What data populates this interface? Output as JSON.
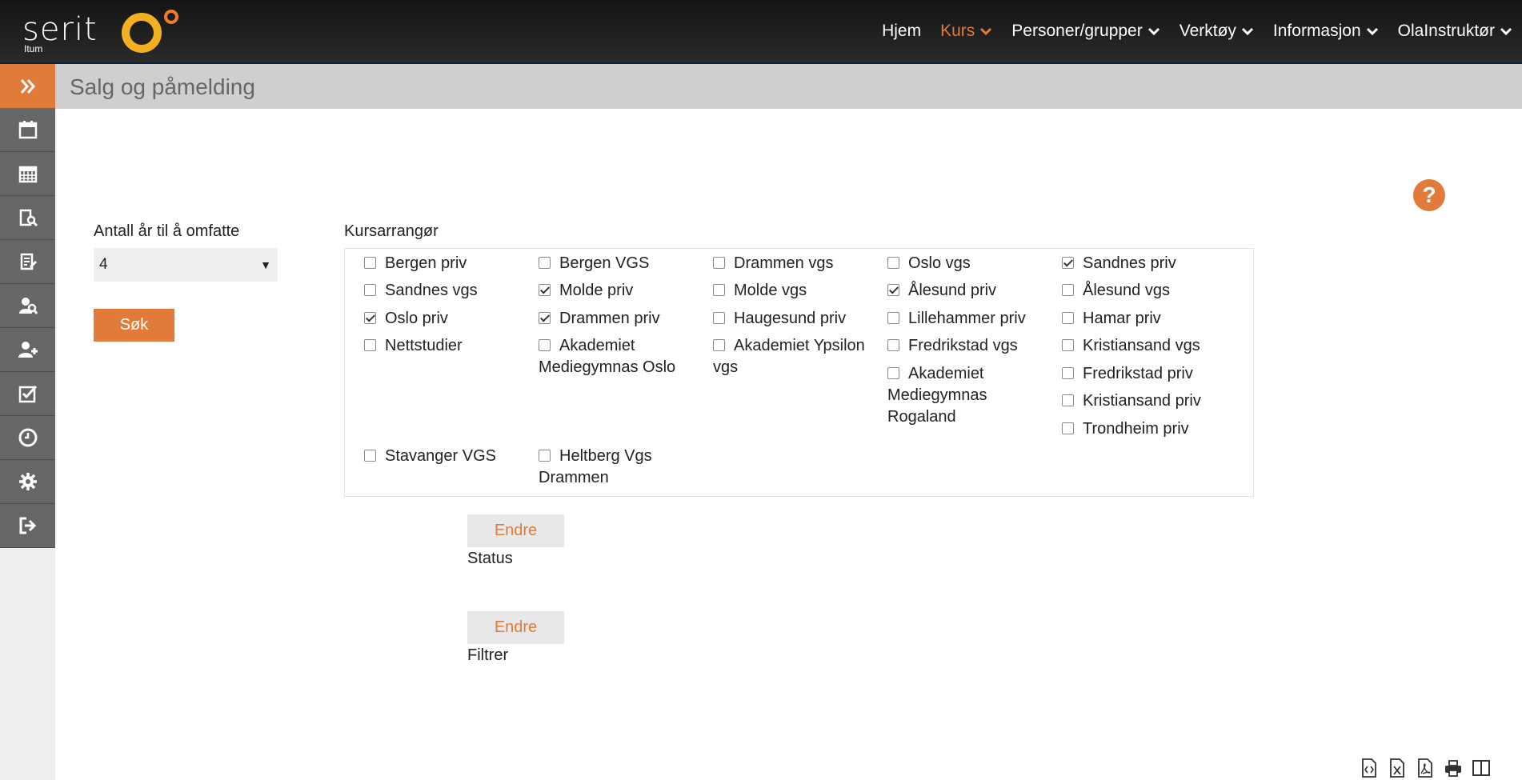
{
  "brand": {
    "logo_text": "serit",
    "logo_sub": "Itum",
    "accent": "#e07b39",
    "ring_color": "#f2b020"
  },
  "nav": [
    {
      "label": "Hjem",
      "active": false,
      "dropdown": false
    },
    {
      "label": "Kurs",
      "active": true,
      "dropdown": true
    },
    {
      "label": "Personer/grupper",
      "active": false,
      "dropdown": true
    },
    {
      "label": "Verktøy",
      "active": false,
      "dropdown": true
    },
    {
      "label": "Informasjon",
      "active": false,
      "dropdown": true
    },
    {
      "label": "OlaInstruktør",
      "active": false,
      "dropdown": true
    }
  ],
  "sidebar": {
    "icons": [
      "expand-icon",
      "calendar-icon",
      "calendar-grid-icon",
      "course-search-icon",
      "course-edit-icon",
      "person-search-icon",
      "add-person-icon",
      "checklist-icon",
      "clock-icon",
      "gear-icon",
      "logout-icon"
    ]
  },
  "page": {
    "title": "Salg og påmelding"
  },
  "form": {
    "years_label": "Antall år til å omfatte",
    "years_value": "4",
    "search_button": "Søk",
    "organizer_label": "Kursarrangør"
  },
  "organizers": [
    {
      "name": "Bergen priv",
      "checked": false
    },
    {
      "name": "Bergen VGS",
      "checked": false
    },
    {
      "name": "Drammen vgs",
      "checked": false
    },
    {
      "name": "Oslo vgs",
      "checked": false
    },
    {
      "name": "Sandnes priv",
      "checked": true
    },
    {
      "name": "Sandnes vgs",
      "checked": false
    },
    {
      "name": "Molde priv",
      "checked": true
    },
    {
      "name": "Molde vgs",
      "checked": false
    },
    {
      "name": "Ålesund priv",
      "checked": true
    },
    {
      "name": "Ålesund vgs",
      "checked": false
    },
    {
      "name": "Oslo priv",
      "checked": true
    },
    {
      "name": "Drammen priv",
      "checked": true
    },
    {
      "name": "Haugesund priv",
      "checked": false
    },
    {
      "name": "Lillehammer priv",
      "checked": false
    },
    {
      "name": "Hamar priv",
      "checked": false
    },
    {
      "name": "Nettstudier",
      "checked": false
    },
    {
      "name": "Akademiet Mediegymnas Oslo",
      "checked": false
    },
    {
      "name": "Akademiet Ypsilon vgs",
      "checked": false
    },
    {
      "name": "Fredrikstad vgs",
      "checked": false
    },
    {
      "name": "Kristiansand vgs",
      "checked": false
    },
    {
      "name": "Akademiet Mediegymnas Rogaland",
      "checked": false
    },
    {
      "name": "Fredrikstad priv",
      "checked": false
    },
    {
      "name": "Kristiansand priv",
      "checked": false
    },
    {
      "name": "Trondheim priv",
      "checked": false
    },
    {
      "name": "Stavanger VGS",
      "checked": false
    },
    {
      "name": "Heltberg Vgs Drammen",
      "checked": false
    }
  ],
  "status": {
    "button": "Endre",
    "label": "Status"
  },
  "filter": {
    "button": "Endre",
    "label": "Filtrer"
  },
  "bottom_icons": [
    "html-export-icon",
    "excel-export-icon",
    "pdf-export-icon",
    "print-icon",
    "columns-icon"
  ]
}
